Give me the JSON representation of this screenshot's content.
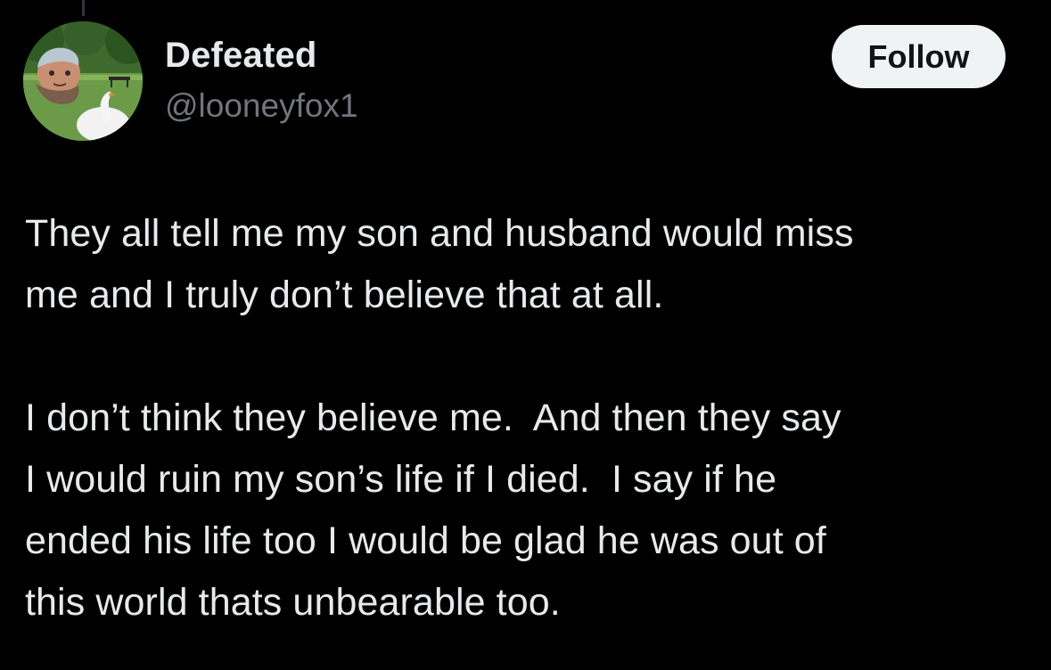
{
  "author": {
    "display_name": "Defeated",
    "handle": "@looneyfox1",
    "avatar_icon": "profile-photo"
  },
  "actions": {
    "follow_label": "Follow"
  },
  "post": {
    "paragraphs": [
      {
        "lines": [
          "They all tell me my son and husband would miss",
          "me and I truly don’t believe that at all."
        ]
      },
      {
        "lines": [
          "I don’t think they believe me.  And then they say",
          "I would ruin my son’s life if I died.  I say if he",
          "ended his life too I would be glad he was out of",
          "this world thats unbearable too."
        ]
      }
    ]
  },
  "colors": {
    "background": "#000000",
    "primary_text": "#e7e9ea",
    "secondary_text": "#71767b",
    "follow_button_bg": "#eff3f4",
    "follow_button_text": "#0f1419"
  }
}
